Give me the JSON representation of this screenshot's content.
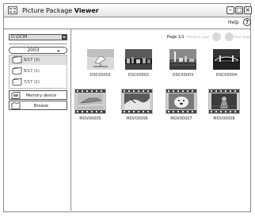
{
  "window": {
    "title_prefix": "Picture Package",
    "title_bold": "Viewer",
    "min_glyph": "–",
    "max_glyph": "□",
    "close_glyph": "×"
  },
  "menu": {
    "help_label": "Help",
    "help_icon_glyph": "?"
  },
  "sidebar": {
    "drive_value": "D:\\DCIM",
    "year_label": "2003",
    "folders": [
      {
        "label": "8/17 (3)",
        "selected": true
      },
      {
        "label": "8/17 (1)",
        "selected": false
      },
      {
        "label": "7/17 (1)",
        "selected": false
      }
    ],
    "memory_device_label": "Memory device",
    "browse_label": "Browse"
  },
  "pager": {
    "page_label": "Page 1/1",
    "prev_label": "Previous page",
    "next_label": "Next page"
  },
  "thumbnails": [
    {
      "label": "DSC00001",
      "kind": "photo",
      "scene": "bird"
    },
    {
      "label": "DSC00002",
      "kind": "photo",
      "scene": "city"
    },
    {
      "label": "DSC00003",
      "kind": "photo",
      "scene": "tower"
    },
    {
      "label": "DSC00004",
      "kind": "photo",
      "scene": "bridge"
    },
    {
      "label": "MOV00005",
      "kind": "movie",
      "scene": "jet"
    },
    {
      "label": "MOV00006",
      "kind": "movie",
      "scene": "wave"
    },
    {
      "label": "MOV00007",
      "kind": "movie",
      "scene": "dog"
    },
    {
      "label": "MOV00008",
      "kind": "movie",
      "scene": "rider"
    }
  ],
  "colors": {
    "border": "#8a8a8a",
    "selected_row": "#e0e0e0",
    "disabled_text": "#b5b5b5"
  }
}
